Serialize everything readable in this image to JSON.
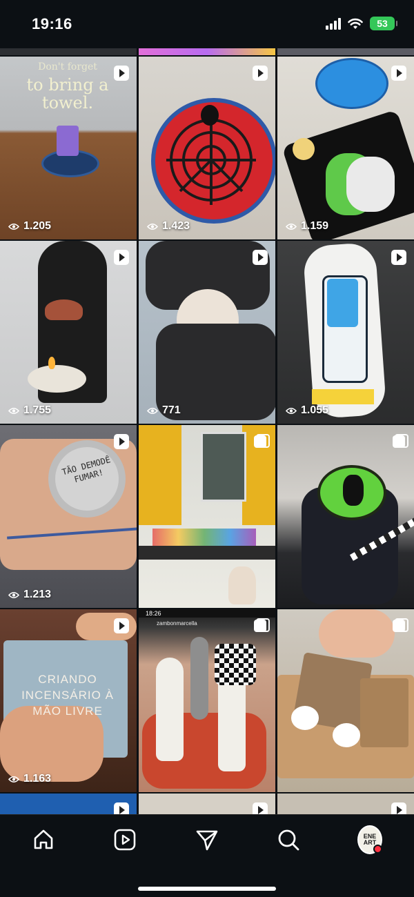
{
  "status_bar": {
    "time": "19:16",
    "battery": "53"
  },
  "grid": {
    "tiles": [
      {
        "id": "t1",
        "views": "1.205",
        "type": "reel",
        "overlay_text": [
          "Don't forget",
          "to bring a",
          "towel."
        ]
      },
      {
        "id": "t2",
        "views": "1.423",
        "type": "reel"
      },
      {
        "id": "t3",
        "views": "1.159",
        "type": "reel"
      },
      {
        "id": "t4",
        "views": "1.755",
        "type": "reel"
      },
      {
        "id": "t5",
        "views": "771",
        "type": "reel"
      },
      {
        "id": "t6",
        "views": "1.055",
        "type": "reel"
      },
      {
        "id": "t7",
        "views": "1.213",
        "type": "reel",
        "overlay_text": [
          "TÃO DEMODÊ",
          "FUMAR!"
        ]
      },
      {
        "id": "t8",
        "type": "carousel"
      },
      {
        "id": "t9",
        "type": "carousel"
      },
      {
        "id": "t10",
        "views": "1.163",
        "type": "reel",
        "overlay_text": [
          "CRIANDO",
          "INCENSÁRIO À",
          "MÃO LIVRE"
        ]
      },
      {
        "id": "t11",
        "type": "carousel",
        "overlay_text": [
          "18:26",
          "zambonmarcella"
        ]
      },
      {
        "id": "t12",
        "type": "carousel"
      }
    ]
  },
  "bottom_nav": {
    "items": [
      "home-icon",
      "reels-icon",
      "messages-icon",
      "search-icon",
      "profile-avatar"
    ],
    "avatar_text": "ENE ART"
  },
  "colors": {
    "background": "#0c1014",
    "notification": "#ff3040",
    "battery": "#34c759"
  }
}
